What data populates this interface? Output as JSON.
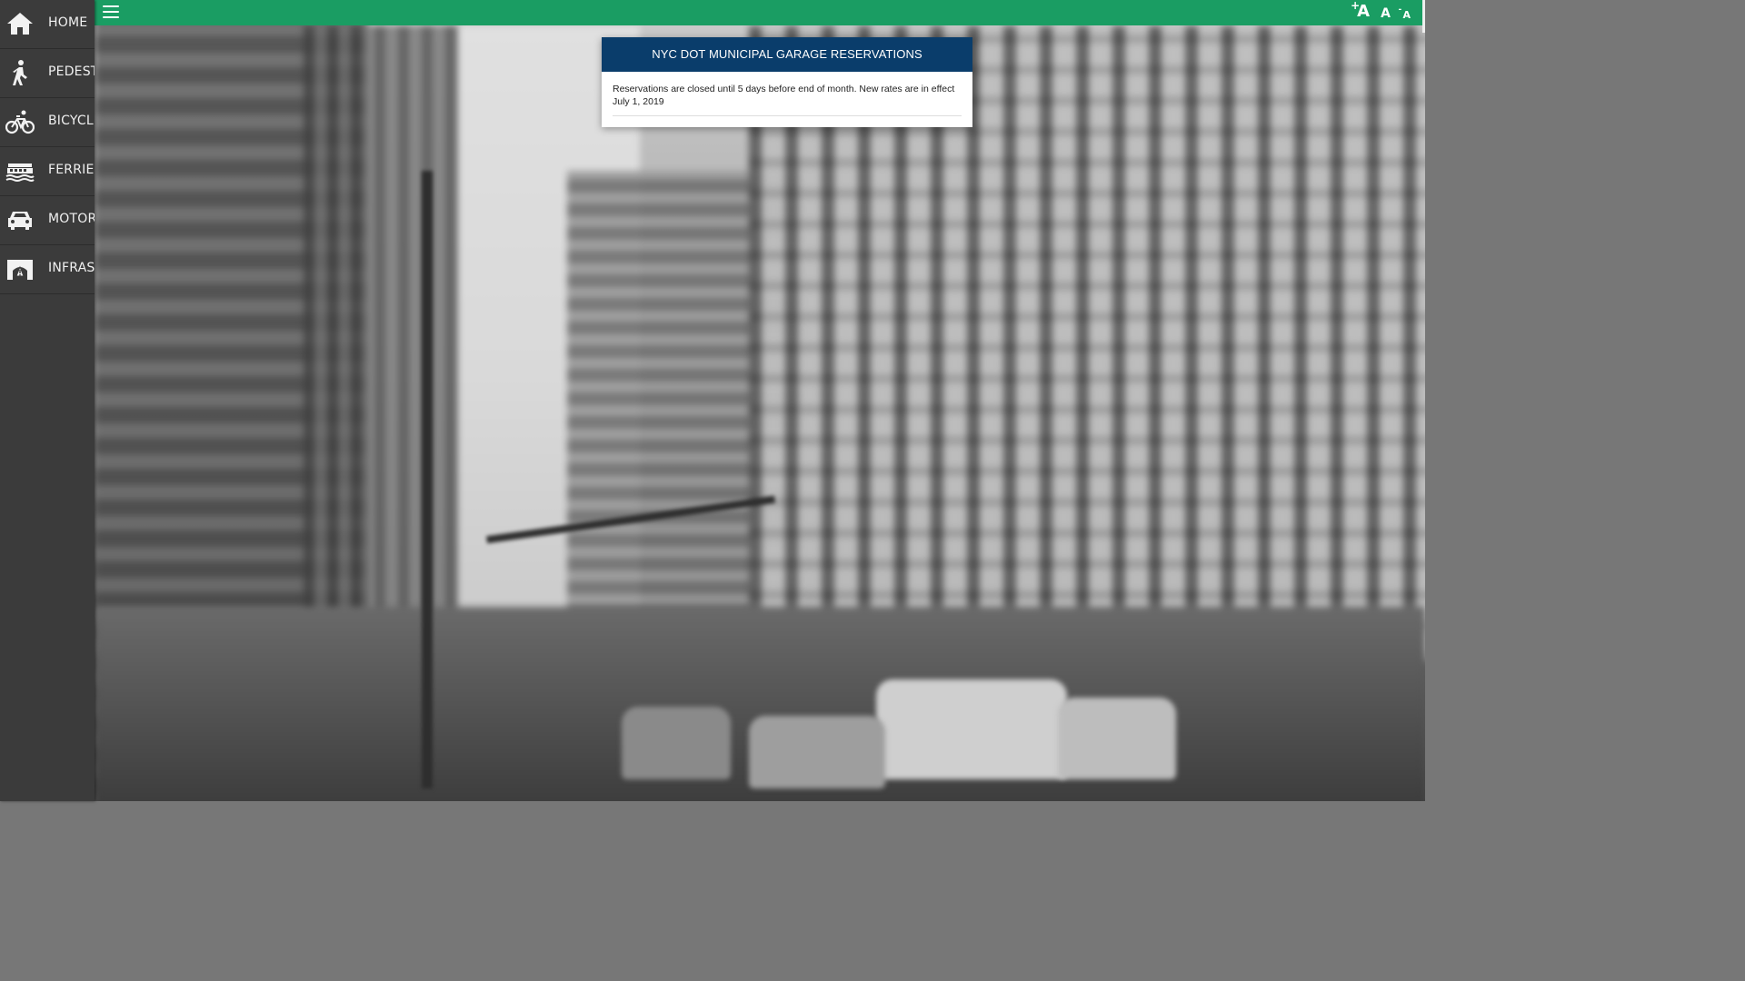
{
  "sidebar": {
    "items": [
      {
        "label": "HOME",
        "icon": "home-icon"
      },
      {
        "label": "PEDEST",
        "icon": "pedestrian-icon"
      },
      {
        "label": "BICYCLIS",
        "icon": "bicycle-icon"
      },
      {
        "label": "FERRIES",
        "icon": "ferry-icon"
      },
      {
        "label": "MOTORI",
        "icon": "car-icon"
      },
      {
        "label": "INFRAST",
        "icon": "bridge-icon"
      }
    ]
  },
  "topbar": {
    "menu_icon": "hamburger-menu-icon",
    "font_increase": "A",
    "font_increase_sign": "+",
    "font_normal": "A",
    "font_decrease": "A",
    "font_decrease_sign": "-"
  },
  "dialog": {
    "title": "NYC DOT MUNICIPAL GARAGE RESERVATIONS",
    "message": "Reservations are closed until 5 days before end of month. New rates are in effect July 1, 2019"
  },
  "colors": {
    "topbar": "#1a9d63",
    "sidebar": "#3b3b3b",
    "dialog_header": "#0a3d6b"
  }
}
